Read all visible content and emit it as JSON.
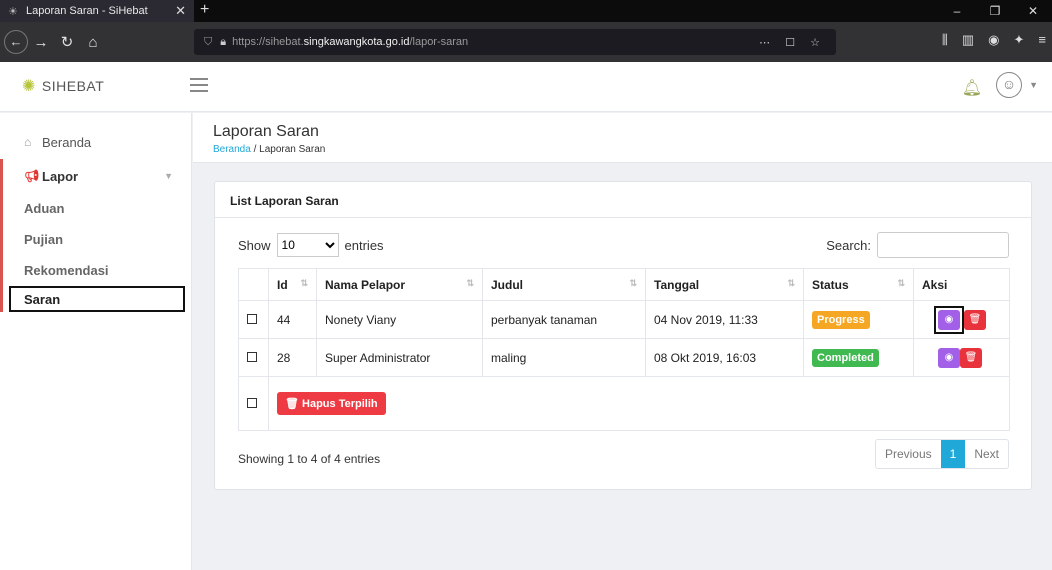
{
  "browser": {
    "tab_title": "Laporan Saran - SiHebat",
    "url_prefix": "https://sihebat.",
    "url_host": "singkawangkota.go.id",
    "url_path": "/lapor-saran"
  },
  "app": {
    "logo_text": "SIHEBAT"
  },
  "sidebar": {
    "beranda": "Beranda",
    "lapor": "Lapor",
    "sub": [
      "Aduan",
      "Pujian",
      "Rekomendasi",
      "Saran"
    ]
  },
  "page": {
    "title": "Laporan Saran",
    "breadcrumb_home": "Beranda",
    "breadcrumb_sep": "/",
    "breadcrumb_current": "Laporan Saran"
  },
  "card": {
    "title": "List Laporan Saran",
    "show_label": "Show",
    "page_size": "10",
    "entries_label": "entries",
    "search_label": "Search:",
    "search_value": ""
  },
  "table": {
    "headers": [
      "Id",
      "Nama Pelapor",
      "Judul",
      "Tanggal",
      "Status",
      "Aksi"
    ],
    "rows": [
      {
        "id": "44",
        "nama": "Nonety Viany",
        "judul": "perbanyak tanaman",
        "tanggal": "04 Nov 2019, 11:33",
        "status": "Progress",
        "status_color": "#f5a623"
      },
      {
        "id": "28",
        "nama": "Super Administrator",
        "judul": "maling",
        "tanggal": "08 Okt 2019, 16:03",
        "status": "Completed",
        "status_color": "#3fb950"
      }
    ],
    "bulk_delete": "Hapus Terpilih"
  },
  "footer": {
    "info": "Showing 1 to 4 of 4 entries",
    "prev": "Previous",
    "page": "1",
    "next": "Next"
  }
}
